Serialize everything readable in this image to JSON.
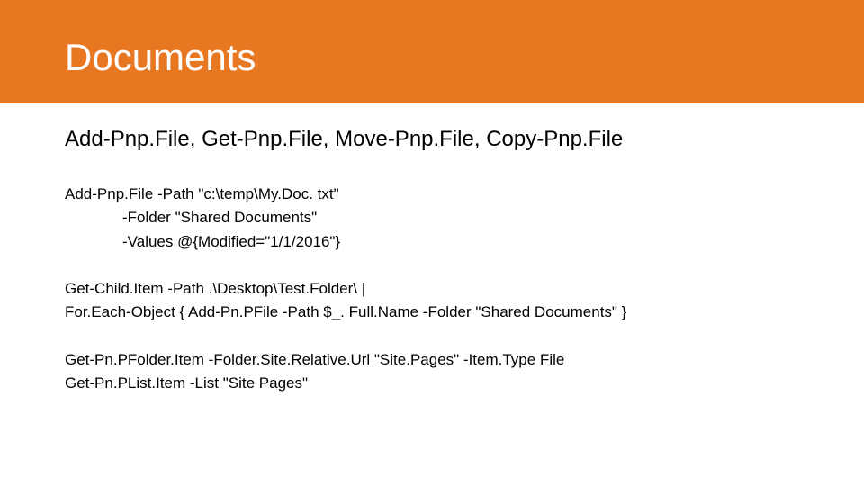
{
  "header": {
    "title": "Documents"
  },
  "subtitle": "Add-Pnp.File, Get-Pnp.File, Move-Pnp.File, Copy-Pnp.File",
  "block1": {
    "l1": "Add-Pnp.File -Path \"c:\\temp\\My.Doc. txt\"",
    "l2": "-Folder \"Shared Documents\"",
    "l3": "-Values @{Modified=\"1/1/2016\"}"
  },
  "block2": {
    "l1": "Get-Child.Item -Path .\\Desktop\\Test.Folder\\ |",
    "l2": "For.Each-Object { Add-Pn.PFile -Path $_. Full.Name -Folder \"Shared Documents\" }"
  },
  "block3": {
    "l1": "Get-Pn.PFolder.Item -Folder.Site.Relative.Url \"Site.Pages\" -Item.Type File",
    "l2": "Get-Pn.PList.Item -List \"Site Pages\""
  }
}
